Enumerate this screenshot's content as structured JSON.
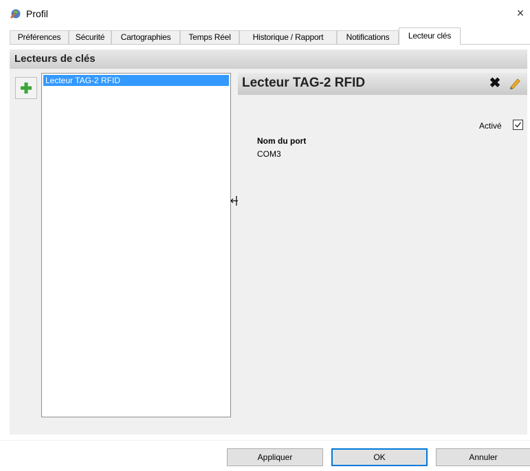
{
  "window": {
    "title": "Profil",
    "close_glyph": "×",
    "app_icon": "app-icon"
  },
  "tabs": [
    {
      "label": "Préférences"
    },
    {
      "label": "Sécurité"
    },
    {
      "label": "Cartographies"
    },
    {
      "label": "Temps Réel"
    },
    {
      "label": "Historique / Rapport"
    },
    {
      "label": "Notifications"
    },
    {
      "label": "Lecteur clés",
      "active": true
    }
  ],
  "section": {
    "title": "Lecteurs de clés"
  },
  "list": {
    "items": [
      {
        "label": "Lecteur TAG-2 RFID",
        "selected": true
      }
    ]
  },
  "detail": {
    "title": "Lecteur TAG-2 RFID",
    "active_label": "Activé",
    "active_checked": true,
    "port_label": "Nom du port",
    "port_value": "COM3",
    "delete_icon": "close-icon",
    "edit_icon": "pencil-icon"
  },
  "footer": {
    "apply_label": "Appliquer",
    "ok_label": "OK",
    "cancel_label": "Annuler"
  },
  "colors": {
    "selection": "#3399ff",
    "accent": "#0078d7",
    "add_green": "#3aa63a",
    "panel_bg": "#f0f0f0"
  }
}
